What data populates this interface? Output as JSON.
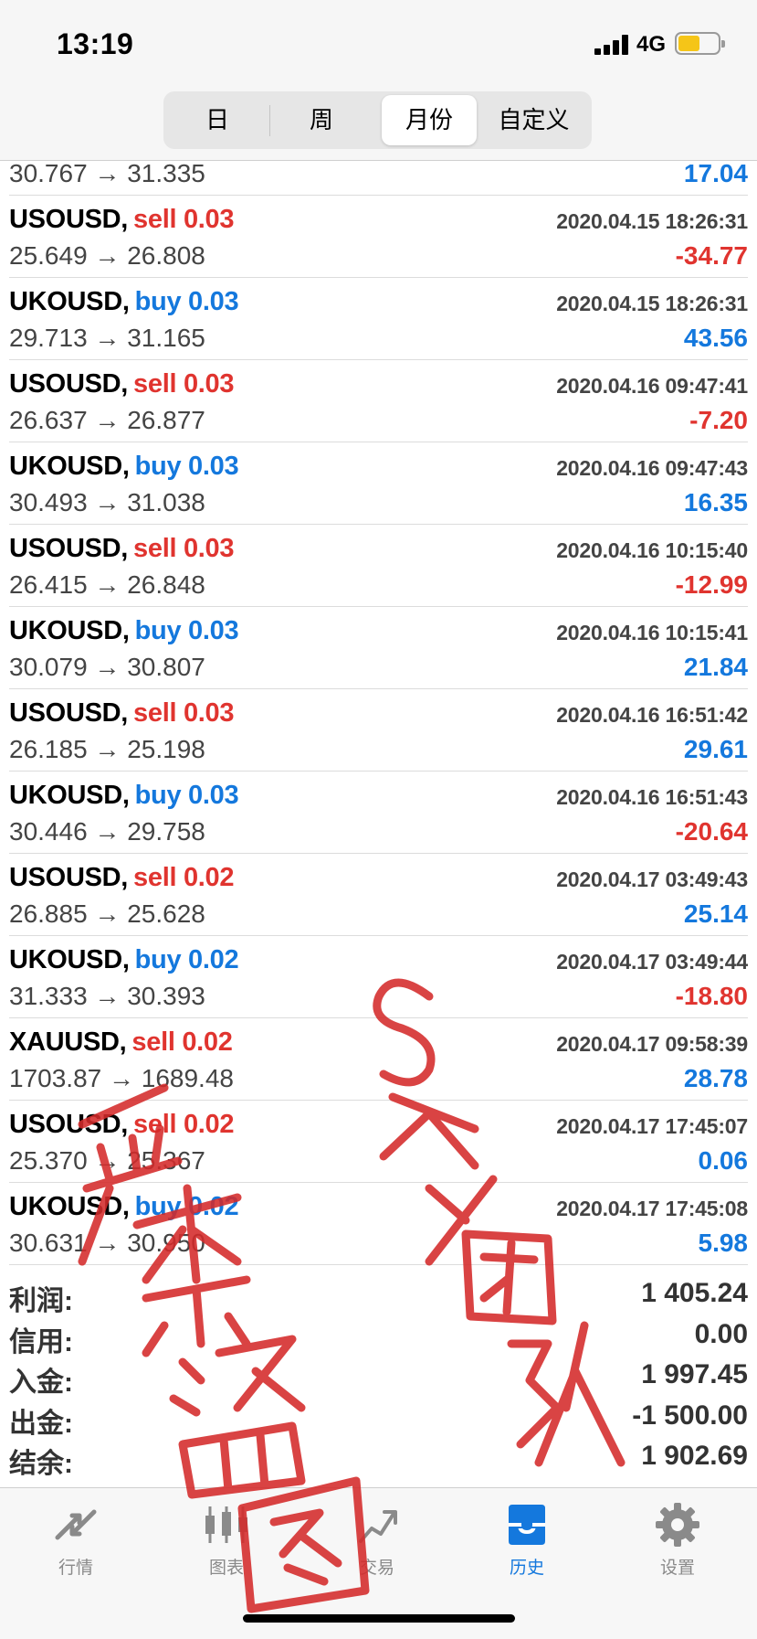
{
  "status": {
    "time": "13:19",
    "network": "4G"
  },
  "segments": [
    "日",
    "周",
    "月份",
    "自定义"
  ],
  "active_segment": "月份",
  "trades_partial": {
    "prices": "30.767 → 31.335",
    "profit": "17.04"
  },
  "trades": [
    {
      "symbol": "USOUSD,",
      "side": "sell",
      "volume": "sell 0.03",
      "datetime": "2020.04.15 18:26:31",
      "prices": "25.649 → 26.808",
      "profit": "-34.77"
    },
    {
      "symbol": "UKOUSD,",
      "side": "buy",
      "volume": "buy 0.03",
      "datetime": "2020.04.15 18:26:31",
      "prices": "29.713 → 31.165",
      "profit": "43.56"
    },
    {
      "symbol": "USOUSD,",
      "side": "sell",
      "volume": "sell 0.03",
      "datetime": "2020.04.16 09:47:41",
      "prices": "26.637 → 26.877",
      "profit": "-7.20"
    },
    {
      "symbol": "UKOUSD,",
      "side": "buy",
      "volume": "buy 0.03",
      "datetime": "2020.04.16 09:47:43",
      "prices": "30.493 → 31.038",
      "profit": "16.35"
    },
    {
      "symbol": "USOUSD,",
      "side": "sell",
      "volume": "sell 0.03",
      "datetime": "2020.04.16 10:15:40",
      "prices": "26.415 → 26.848",
      "profit": "-12.99"
    },
    {
      "symbol": "UKOUSD,",
      "side": "buy",
      "volume": "buy 0.03",
      "datetime": "2020.04.16 10:15:41",
      "prices": "30.079 → 30.807",
      "profit": "21.84"
    },
    {
      "symbol": "USOUSD,",
      "side": "sell",
      "volume": "sell 0.03",
      "datetime": "2020.04.16 16:51:42",
      "prices": "26.185 → 25.198",
      "profit": "29.61"
    },
    {
      "symbol": "UKOUSD,",
      "side": "buy",
      "volume": "buy 0.03",
      "datetime": "2020.04.16 16:51:43",
      "prices": "30.446 → 29.758",
      "profit": "-20.64"
    },
    {
      "symbol": "USOUSD,",
      "side": "sell",
      "volume": "sell 0.02",
      "datetime": "2020.04.17 03:49:43",
      "prices": "26.885 → 25.628",
      "profit": "25.14"
    },
    {
      "symbol": "UKOUSD,",
      "side": "buy",
      "volume": "buy 0.02",
      "datetime": "2020.04.17 03:49:44",
      "prices": "31.333 → 30.393",
      "profit": "-18.80"
    },
    {
      "symbol": "XAUUSD,",
      "side": "sell",
      "volume": "sell 0.02",
      "datetime": "2020.04.17 09:58:39",
      "prices": "1703.87 → 1689.48",
      "profit": "28.78"
    },
    {
      "symbol": "USOUSD,",
      "side": "sell",
      "volume": "sell 0.02",
      "datetime": "2020.04.17 17:45:07",
      "prices": "25.370 → 25.367",
      "profit": "0.06"
    },
    {
      "symbol": "UKOUSD,",
      "side": "buy",
      "volume": "buy 0.02",
      "datetime": "2020.04.17 17:45:08",
      "prices": "30.631 → 30.950",
      "profit": "5.98"
    }
  ],
  "summary": [
    {
      "label": "利润:",
      "value": "1 405.24"
    },
    {
      "label": "信用:",
      "value": "0.00"
    },
    {
      "label": "入金:",
      "value": "1 997.45"
    },
    {
      "label": "出金:",
      "value": "-1 500.00"
    },
    {
      "label": "结余:",
      "value": "1 902.69"
    }
  ],
  "tabs": [
    {
      "label": "行情",
      "icon": "quotes-icon"
    },
    {
      "label": "图表",
      "icon": "chart-icon"
    },
    {
      "label": "交易",
      "icon": "trade-icon"
    },
    {
      "label": "历史",
      "icon": "history-icon"
    },
    {
      "label": "设置",
      "icon": "settings-icon"
    }
  ],
  "active_tab": "历史",
  "colors": {
    "sell": "#e0342f",
    "buy": "#1478dd",
    "profit_positive": "#1478dd",
    "profit_negative": "#e0342f",
    "battery": "#f5c518",
    "watermark": "#d42a2a"
  },
  "watermark": {
    "text_vertical_1": "Sky团队",
    "text_vertical_2": "严禁盗图"
  }
}
